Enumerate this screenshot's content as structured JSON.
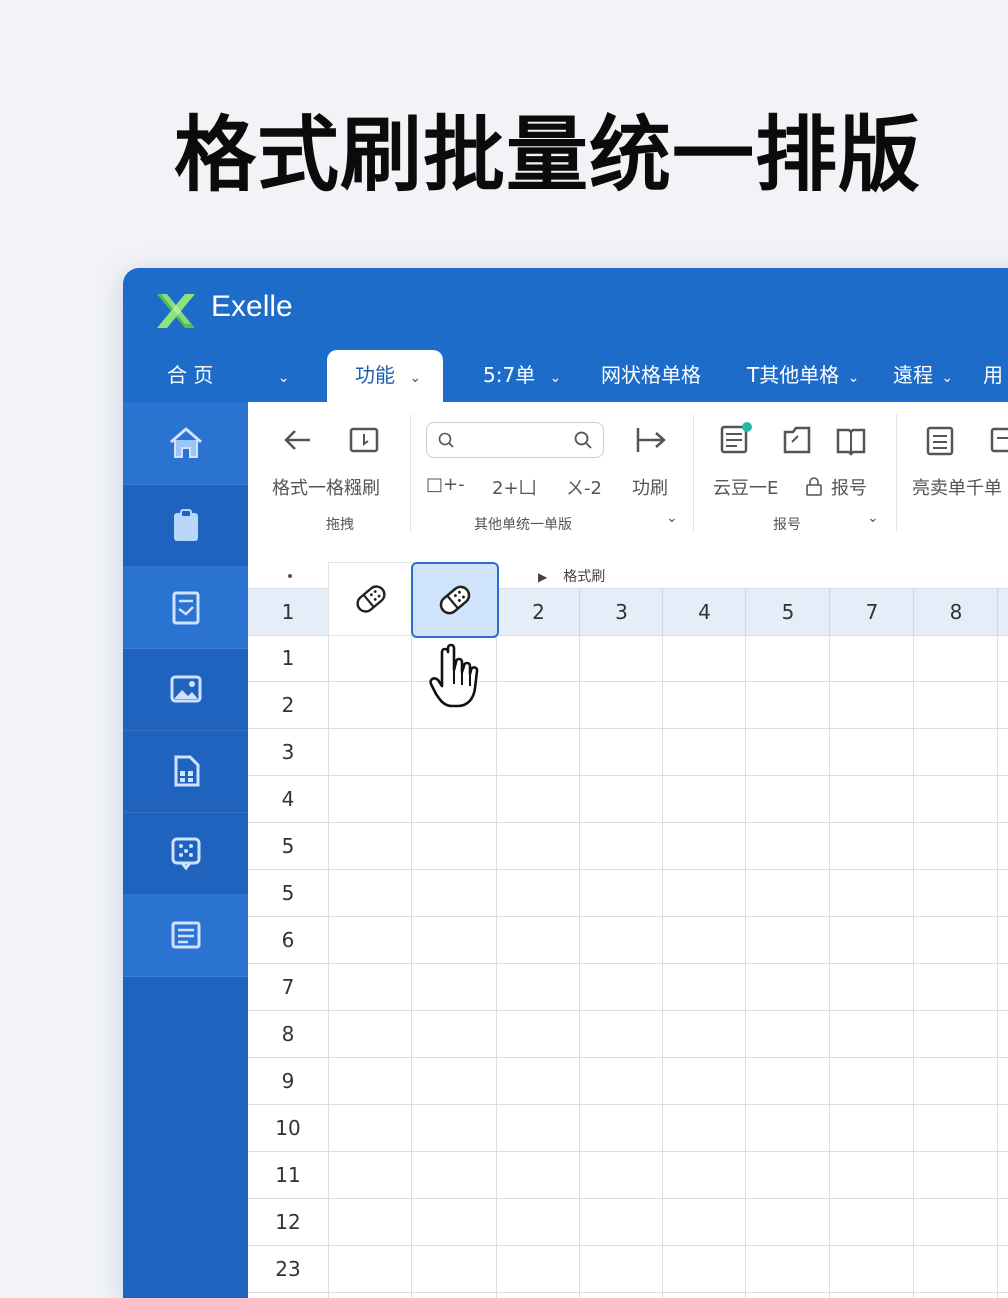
{
  "headline": "格式刷批量统一排版",
  "app": {
    "name": "Exelle"
  },
  "tabs": [
    {
      "label": "合  页",
      "has_chevron": true
    },
    {
      "label": "功能",
      "active": true
    },
    {
      "label": "5:7单"
    },
    {
      "label": "网状格单格"
    },
    {
      "label": "T其他单格"
    },
    {
      "label": "遠程"
    },
    {
      "label": "用"
    }
  ],
  "sidebar": {
    "items": [
      "home-icon",
      "clipboard-icon",
      "document-edit-icon",
      "image-icon",
      "calculator-icon",
      "grid-dialog-icon",
      "notes-icon"
    ]
  },
  "ribbon": {
    "group1": {
      "label": "拖拽",
      "text": "格式一格糨刷"
    },
    "group2": {
      "label": "其他单统一单版",
      "text_a": "□+-",
      "text_b": "2+凵",
      "text_c": "ㄨ-2",
      "text_d": "功刷"
    },
    "group3": {
      "label": "报号",
      "text_a": "云豆一E",
      "text_b": "报号"
    },
    "group4": {
      "text": "亮卖单千单"
    }
  },
  "formula_bar": {
    "breadcrumb": "格式刷"
  },
  "grid": {
    "corner": "1",
    "column_headers": [
      "2",
      "3",
      "4",
      "5",
      "7",
      "8"
    ],
    "row_headers": [
      "1",
      "2",
      "3",
      "4",
      "5",
      "5",
      "6",
      "7",
      "8",
      "9",
      "10",
      "11",
      "12",
      "23"
    ]
  },
  "colors": {
    "titlebar": "#1e6cc9",
    "sidebar": "#1f63bf",
    "active_brush_bg": "#cfe3fb",
    "active_brush_border": "#2a6fcb"
  }
}
